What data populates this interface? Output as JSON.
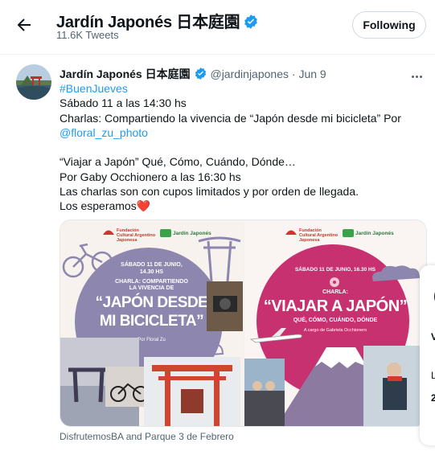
{
  "header": {
    "account_name": "Jardín Japonés 日本庭園",
    "tweet_count": "11.6K Tweets",
    "follow_label": "Following"
  },
  "tweet": {
    "name": "Jardín Japonés 日本庭園",
    "handle": "@jardinjapones",
    "separator": "·",
    "date": "Jun 9",
    "lines": {
      "l1": "#BuenJueves",
      "l2": "Sábado 11 a las 14:30 hs",
      "l3": "Charlas: Compartiendo la vivencia de “Japón desde mi bicicleta” Por",
      "l4": "@floral_zu_photo",
      "l5": "“Viajar a Japón” Qué, Cómo, Cuándo, Dónde…",
      "l6": "Por Gaby Occhionero a las 16:30 hs",
      "l7": "Las charlas son con cupos limitados y por orden de llegada.",
      "l8": "Los esperamos",
      "heart": "❤️"
    },
    "media_credit": "DisfrutemosBA and Parque 3 de Febrero"
  },
  "poster_left": {
    "org1": "Fundación Cultural Argentino Japonesa",
    "org2": "Jardín Japonés",
    "date": "SÁBADO 11 DE JUNIO,",
    "time": "14.30 HS",
    "kicker1": "CHARLA: COMPARTIENDO",
    "kicker2": "LA VIVENCIA DE",
    "title1": "“JAPÓN DESDE",
    "title2": "MI BICICLETA”",
    "byline": "Por Floral Zu"
  },
  "poster_right": {
    "org1": "Fundación Cultural Argentino Japonesa",
    "org2": "Jardín Japonés",
    "date": "SÁBADO 11 DE JUNIO, 16.30 HS",
    "kicker": "CHARLA:",
    "title": "“VIAJAR A JAPÓN”",
    "subtitle": "QUÉ, CÓMO, CUÁNDO, DÓNDE",
    "byline": "A cargo de Gabriela Occhionero"
  },
  "side_card": {
    "t1": "V",
    "t2": "L",
    "t3": "2"
  },
  "colors": {
    "accent": "#1d9bf0",
    "text": "#0f1419",
    "muted": "#536471",
    "poster_purple": "#8d86ae",
    "poster_magenta": "#c8316f"
  },
  "icons": {
    "back": "arrow-left-icon",
    "verified": "verified-badge-icon",
    "more": "more-dots-icon"
  }
}
